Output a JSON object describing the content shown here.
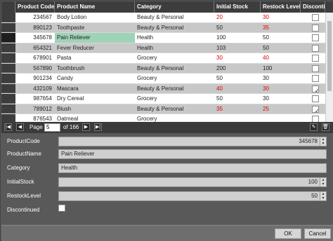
{
  "columns": [
    "Product Code",
    "Product Name",
    "Category",
    "Initial Stock",
    "Restock Level",
    "Discontinue"
  ],
  "rows": [
    {
      "code": "234567",
      "name": "Body Lotion",
      "category": "Beauty & Personal",
      "initial": "20",
      "restock": "30",
      "initial_red": true,
      "restock_red": true,
      "discontinued": false
    },
    {
      "code": "890123",
      "name": "Toothpaste",
      "category": "Beauty & Personal",
      "initial": "50",
      "restock": "35",
      "initial_red": false,
      "restock_red": true,
      "discontinued": false
    },
    {
      "code": "345678",
      "name": "Pain Reliever",
      "category": "Health",
      "initial": "100",
      "restock": "50",
      "initial_red": false,
      "restock_red": false,
      "discontinued": false
    },
    {
      "code": "654321",
      "name": "Fever Reducer",
      "category": "Health",
      "initial": "103",
      "restock": "50",
      "initial_red": false,
      "restock_red": false,
      "discontinued": false
    },
    {
      "code": "678901",
      "name": "Pasta",
      "category": "Grocery",
      "initial": "30",
      "restock": "40",
      "initial_red": true,
      "restock_red": true,
      "discontinued": false
    },
    {
      "code": "567890",
      "name": "Toothbrush",
      "category": "Beauty & Personal",
      "initial": "200",
      "restock": "100",
      "initial_red": false,
      "restock_red": false,
      "discontinued": false
    },
    {
      "code": "901234",
      "name": "Candy",
      "category": "Grocery",
      "initial": "50",
      "restock": "30",
      "initial_red": false,
      "restock_red": false,
      "discontinued": false
    },
    {
      "code": "432109",
      "name": "Mascara",
      "category": "Beauty & Personal",
      "initial": "40",
      "restock": "30",
      "initial_red": true,
      "restock_red": true,
      "discontinued": true
    },
    {
      "code": "987654",
      "name": "Dry Cereal",
      "category": "Grocery",
      "initial": "50",
      "restock": "30",
      "initial_red": false,
      "restock_red": false,
      "discontinued": false
    },
    {
      "code": "789012",
      "name": "Blush",
      "category": "Beauty & Personal",
      "initial": "35",
      "restock": "25",
      "initial_red": true,
      "restock_red": true,
      "discontinued": true
    },
    {
      "code": "876543",
      "name": "Oatmeal",
      "category": "Grocery",
      "initial": "",
      "restock": "",
      "initial_red": false,
      "restock_red": false,
      "discontinued": false
    }
  ],
  "pager": {
    "page_label": "Page",
    "page_value": "5",
    "of_label": "of 166"
  },
  "form": {
    "product_code_label": "ProductCode",
    "product_code": "345678",
    "product_name_label": "ProductName",
    "product_name": "Pain Reliever",
    "category_label": "Category",
    "category": "Health",
    "initial_stock_label": "InitialStock",
    "initial_stock": "100",
    "restock_level_label": "RestockLevel",
    "restock_level": "50",
    "discontinued_label": "Discontinued"
  },
  "footer": {
    "ok_label": "OK",
    "cancel_label": "Cancel"
  },
  "colors": {
    "header_bg": "#3d3d3d",
    "selection": "#9fd3b8",
    "alert_text": "#dd0000"
  },
  "icons": [
    "first-page-icon",
    "prev-page-icon",
    "next-page-icon",
    "last-page-icon",
    "edit-icon",
    "delete-icon",
    "spin-up-icon",
    "spin-down-icon"
  ]
}
